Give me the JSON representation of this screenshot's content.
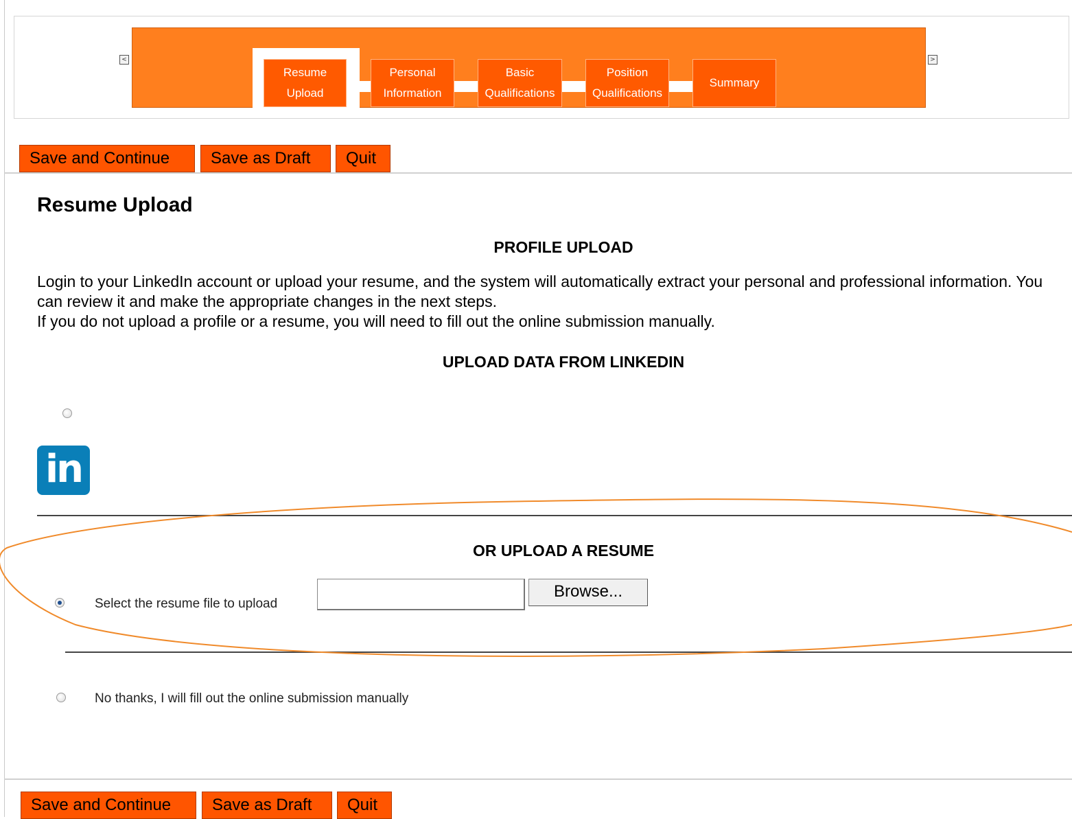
{
  "steps": {
    "prev_arrow": "<",
    "next_arrow": ">",
    "items": [
      {
        "line1": "Resume",
        "line2": "Upload"
      },
      {
        "line1": "Personal",
        "line2": "Information"
      },
      {
        "line1": "Basic",
        "line2": "Qualifications"
      },
      {
        "line1": "Position",
        "line2": "Qualifications"
      },
      {
        "line1": "Summary",
        "line2": ""
      }
    ]
  },
  "toolbar": {
    "save_continue": "Save and Continue",
    "save_draft": "Save as Draft",
    "quit": "Quit"
  },
  "page": {
    "title": "Resume Upload",
    "profile_upload_heading": "PROFILE UPLOAD",
    "intro_line1": "Login to your LinkedIn account or upload your resume, and the system will automatically extract your personal and professional information. You can review it and make the appropriate changes in the next steps.",
    "intro_line2": "If you do not upload a profile or a resume, you will need to fill out the online submission manually.",
    "linkedin_heading": "UPLOAD DATA FROM LINKEDIN",
    "linkedin_logo_text": "in",
    "resume_heading": "OR UPLOAD A RESUME",
    "resume_option_label": "Select the resume file to upload",
    "file_value": "",
    "browse_label": "Browse...",
    "manual_option_label": "No thanks, I will fill out the online submission manually"
  },
  "colors": {
    "accent_orange": "#ff7f1e",
    "button_orange": "#ff5500",
    "linkedin_blue": "#0a7fb8"
  }
}
